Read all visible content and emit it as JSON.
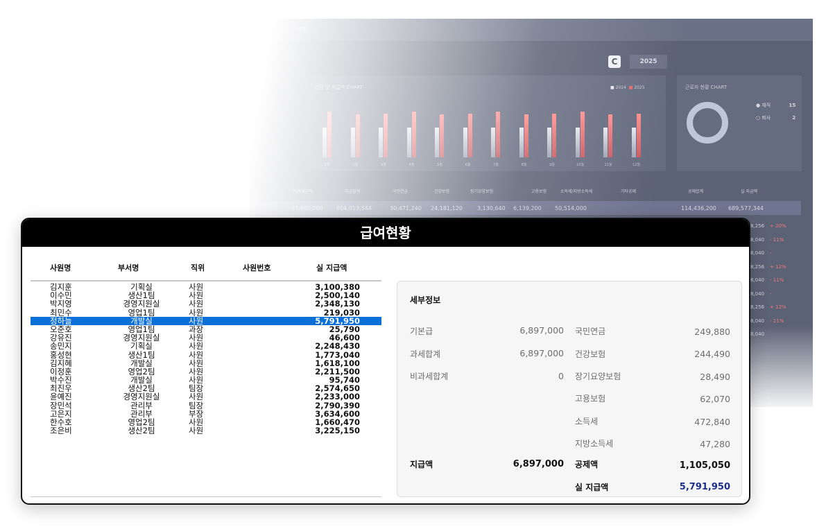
{
  "background": {
    "title": "ezaccount 계정",
    "year": "2025",
    "chart_title": "연간 실 지급액 CHART",
    "legend": [
      "2024",
      "2025"
    ],
    "month_labels": [
      "1월",
      "2월",
      "3월",
      "4월",
      "5월",
      "6월",
      "7월",
      "8월",
      "9월",
      "10월",
      "11월",
      "12월"
    ],
    "donut_title": "근로자 현황 CHART",
    "donut_legend": [
      {
        "label": "재직",
        "value": "15"
      },
      {
        "label": "퇴사",
        "value": "2"
      }
    ],
    "table_headers": [
      "비과세금액",
      "지급합계",
      "국민연금",
      "건강보험",
      "장기요양보험",
      "고용보험",
      "소득세/지방소득세",
      "기타공제",
      "공제합계",
      "실 지급액"
    ],
    "totals": [
      "53,600,000",
      "804,013,544",
      "30,471,240",
      "24,181,120",
      "3,130,640",
      "6,139,200",
      "50,514,000",
      "114,436,200",
      "689,577,344"
    ],
    "row_values": [
      {
        "v": "8,256",
        "p": "+ 20%"
      },
      {
        "v": "8,040",
        "p": "- 11%"
      },
      {
        "v": "8,040",
        "p": "-"
      },
      {
        "v": "8,256",
        "p": "+ 12%"
      },
      {
        "v": "8,040",
        "p": "- 11%"
      },
      {
        "v": "8,040",
        "p": "-"
      },
      {
        "v": "8,256",
        "p": "+ 12%"
      },
      {
        "v": "8,040",
        "p": "- 11%"
      },
      {
        "v": "8,040",
        "p": ""
      }
    ]
  },
  "panel": {
    "title": "급여현황",
    "columns": {
      "name": "사원명",
      "dept": "부서명",
      "position": "직위",
      "emp_no": "사원번호",
      "net_pay": "실 지급액"
    },
    "employees": [
      {
        "name": "김지훈",
        "dept": "기획실",
        "position": "사원",
        "net": "3,100,380"
      },
      {
        "name": "이수민",
        "dept": "생산1팀",
        "position": "사원",
        "net": "2,500,140"
      },
      {
        "name": "박지영",
        "dept": "경영지원실",
        "position": "사원",
        "net": "2,348,130"
      },
      {
        "name": "최민수",
        "dept": "영업1팀",
        "position": "사원",
        "net": "219,030"
      },
      {
        "name": "정하늘",
        "dept": "개발실",
        "position": "사원",
        "net": "5,791,950",
        "selected": true
      },
      {
        "name": "오준호",
        "dept": "영업1팀",
        "position": "과장",
        "net": "25,790"
      },
      {
        "name": "강유진",
        "dept": "경영지원실",
        "position": "사원",
        "net": "46,600"
      },
      {
        "name": "송민지",
        "dept": "기획실",
        "position": "사원",
        "net": "2,248,430"
      },
      {
        "name": "홍성현",
        "dept": "생산1팀",
        "position": "사원",
        "net": "1,773,040"
      },
      {
        "name": "김지혜",
        "dept": "개발실",
        "position": "사원",
        "net": "1,618,100"
      },
      {
        "name": "이정훈",
        "dept": "영업2팀",
        "position": "사원",
        "net": "2,211,500"
      },
      {
        "name": "박수진",
        "dept": "개발실",
        "position": "사원",
        "net": "95,740"
      },
      {
        "name": "최진우",
        "dept": "생산2팀",
        "position": "팀장",
        "net": "2,574,650"
      },
      {
        "name": "윤예진",
        "dept": "경영지원실",
        "position": "사원",
        "net": "2,233,000"
      },
      {
        "name": "장민석",
        "dept": "관리부",
        "position": "팀장",
        "net": "2,790,390"
      },
      {
        "name": "고은지",
        "dept": "관리부",
        "position": "부장",
        "net": "3,634,600"
      },
      {
        "name": "한수호",
        "dept": "영업2팀",
        "position": "사원",
        "net": "1,660,470"
      },
      {
        "name": "조은비",
        "dept": "생산2팀",
        "position": "사원",
        "net": "3,225,150"
      }
    ],
    "detail": {
      "title": "세부정보",
      "base_pay": {
        "label": "기본급",
        "value": "6,897,000"
      },
      "taxable_total": {
        "label": "과세합계",
        "value": "6,897,000"
      },
      "nontaxable_total": {
        "label": "비과세합계",
        "value": "0"
      },
      "pension": {
        "label": "국민연금",
        "value": "249,880"
      },
      "health": {
        "label": "건강보험",
        "value": "244,490"
      },
      "longterm_care": {
        "label": "장기요양보험",
        "value": "28,490"
      },
      "employment": {
        "label": "고용보험",
        "value": "62,070"
      },
      "income_tax": {
        "label": "소득세",
        "value": "472,840"
      },
      "local_tax": {
        "label": "지방소득세",
        "value": "47,280"
      },
      "paid": {
        "label": "지급액",
        "value": "6,897,000"
      },
      "deduction": {
        "label": "공제액",
        "value": "1,105,050"
      },
      "net": {
        "label": "실 지급액",
        "value": "5,791,950"
      }
    }
  }
}
